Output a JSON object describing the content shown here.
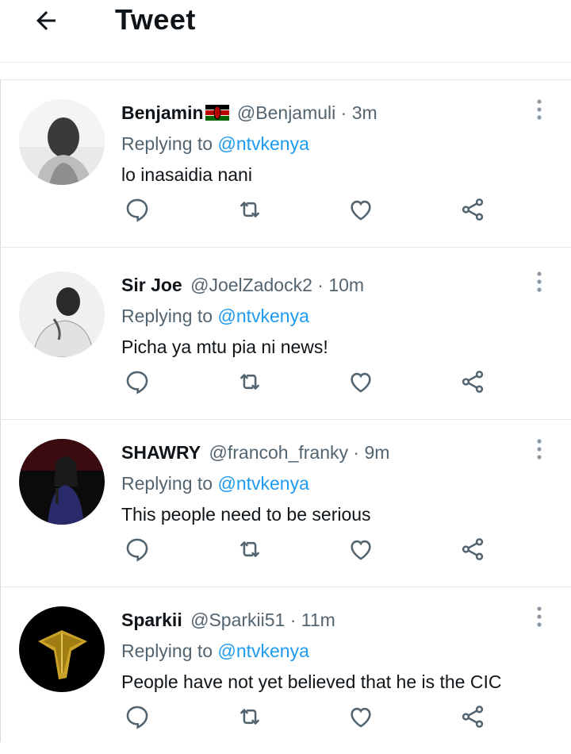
{
  "header": {
    "title": "Tweet"
  },
  "colors": {
    "accent": "#1d9bf0",
    "muted": "#536471",
    "text": "#0f1419"
  },
  "tweets": [
    {
      "name": "Benjamin",
      "has_flag": true,
      "handle": "@Benjamuli",
      "time": "· 3m",
      "replying_prefix": "Replying to",
      "replying_to": "@ntvkenya",
      "text": "lo inasaidia nani",
      "avatar": "avatar-benjamin"
    },
    {
      "name": "Sir Joe",
      "has_flag": false,
      "handle": "@JoelZadock2",
      "time": "· 10m",
      "replying_prefix": "Replying to",
      "replying_to": "@ntvkenya",
      "text": "Picha ya mtu pia ni news!",
      "avatar": "avatar-sir-joe"
    },
    {
      "name": "SHAWRY",
      "has_flag": false,
      "handle": "@francoh_franky",
      "time": "· 9m",
      "replying_prefix": "Replying to",
      "replying_to": "@ntvkenya",
      "text": "This people need to be serious",
      "avatar": "avatar-shawry"
    },
    {
      "name": "Sparkii",
      "has_flag": false,
      "handle": "@Sparkii51",
      "time": "· 11m",
      "replying_prefix": "Replying to",
      "replying_to": "@ntvkenya",
      "text": "People have not yet believed that he is the CIC",
      "avatar": "avatar-sparkii"
    }
  ],
  "icons": [
    "back-arrow-icon",
    "reply-icon",
    "retweet-icon",
    "like-icon",
    "share-icon",
    "more-options-icon",
    "kenya-flag-icon"
  ]
}
